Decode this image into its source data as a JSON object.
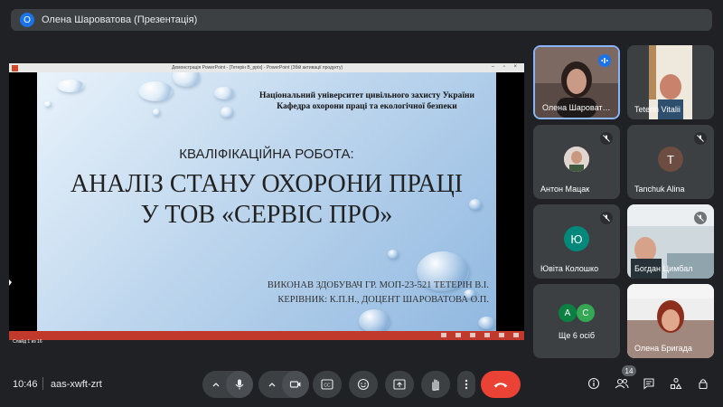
{
  "app": {
    "presenter_badge": "О",
    "presenter_title": "Олена Шароватова (Презентація)"
  },
  "powerpoint": {
    "window_title": "Демонстрація PowerPoint - [Тетерін В_ррtx] - PowerPoint (Збій активації продукту)",
    "status_text": "Слайд 1 из 16"
  },
  "slide": {
    "header_line1": "Національний університет цивільного захисту України",
    "header_line2": "Кафедра охорони праці та екологічної безпеки",
    "subtitle": "КВАЛІФІКАЦІЙНА РОБОТА:",
    "title_line1": "АНАЛІЗ СТАНУ ОХОРОНИ ПРАЦІ",
    "title_line2": "У ТОВ «СЕРВІС ПРО»",
    "footer_line1": "ВИКОНАВ ЗДОБУВАЧ ГР. МОП-23-521 ТЕТЕРІН В.І.",
    "footer_line2": "КЕРІВНИК: К.П.Н., ДОЦЕНТ ШАРОВАТОВА О.П."
  },
  "participants": [
    {
      "name": "Олена Шароват…",
      "mic": "speaking",
      "type": "video"
    },
    {
      "name": "Teterin Vitalii",
      "mic": "none",
      "type": "video"
    },
    {
      "name": "Антон Мацак",
      "mic": "muted",
      "type": "photo",
      "initial": ""
    },
    {
      "name": "Tanchuk Alina",
      "mic": "muted",
      "type": "avatar",
      "initial": "T",
      "color": "#6d4c41"
    },
    {
      "name": "Ювіта Колошко",
      "mic": "muted",
      "type": "avatar",
      "initial": "Ю",
      "color": "#00897b"
    },
    {
      "name": "Богдан Цимбал",
      "mic": "muted",
      "type": "video"
    },
    {
      "name": "Ще 6 осіб",
      "mic": "none",
      "type": "others",
      "initials": [
        "А",
        "C"
      ],
      "colors": [
        "#0b8043",
        "#34a853"
      ]
    },
    {
      "name": "Олена Бригада",
      "mic": "none",
      "type": "video"
    }
  ],
  "bottom": {
    "time": "10:46",
    "meeting_code": "aas-xwft-zrt",
    "participant_count": "14",
    "colors": {
      "end_call": "#ea4335",
      "button_bg": "#3c4043"
    },
    "controls": [
      "chevron-up-icon",
      "mic-icon",
      "chevron-up-icon",
      "camera-icon",
      "captions-icon",
      "emoji-icon",
      "present-icon",
      "raise-hand-icon",
      "more-icon",
      "end-call-icon"
    ],
    "right_icons": [
      "info-icon",
      "people-icon",
      "chat-icon",
      "activities-icon",
      "host-controls-icon"
    ]
  }
}
